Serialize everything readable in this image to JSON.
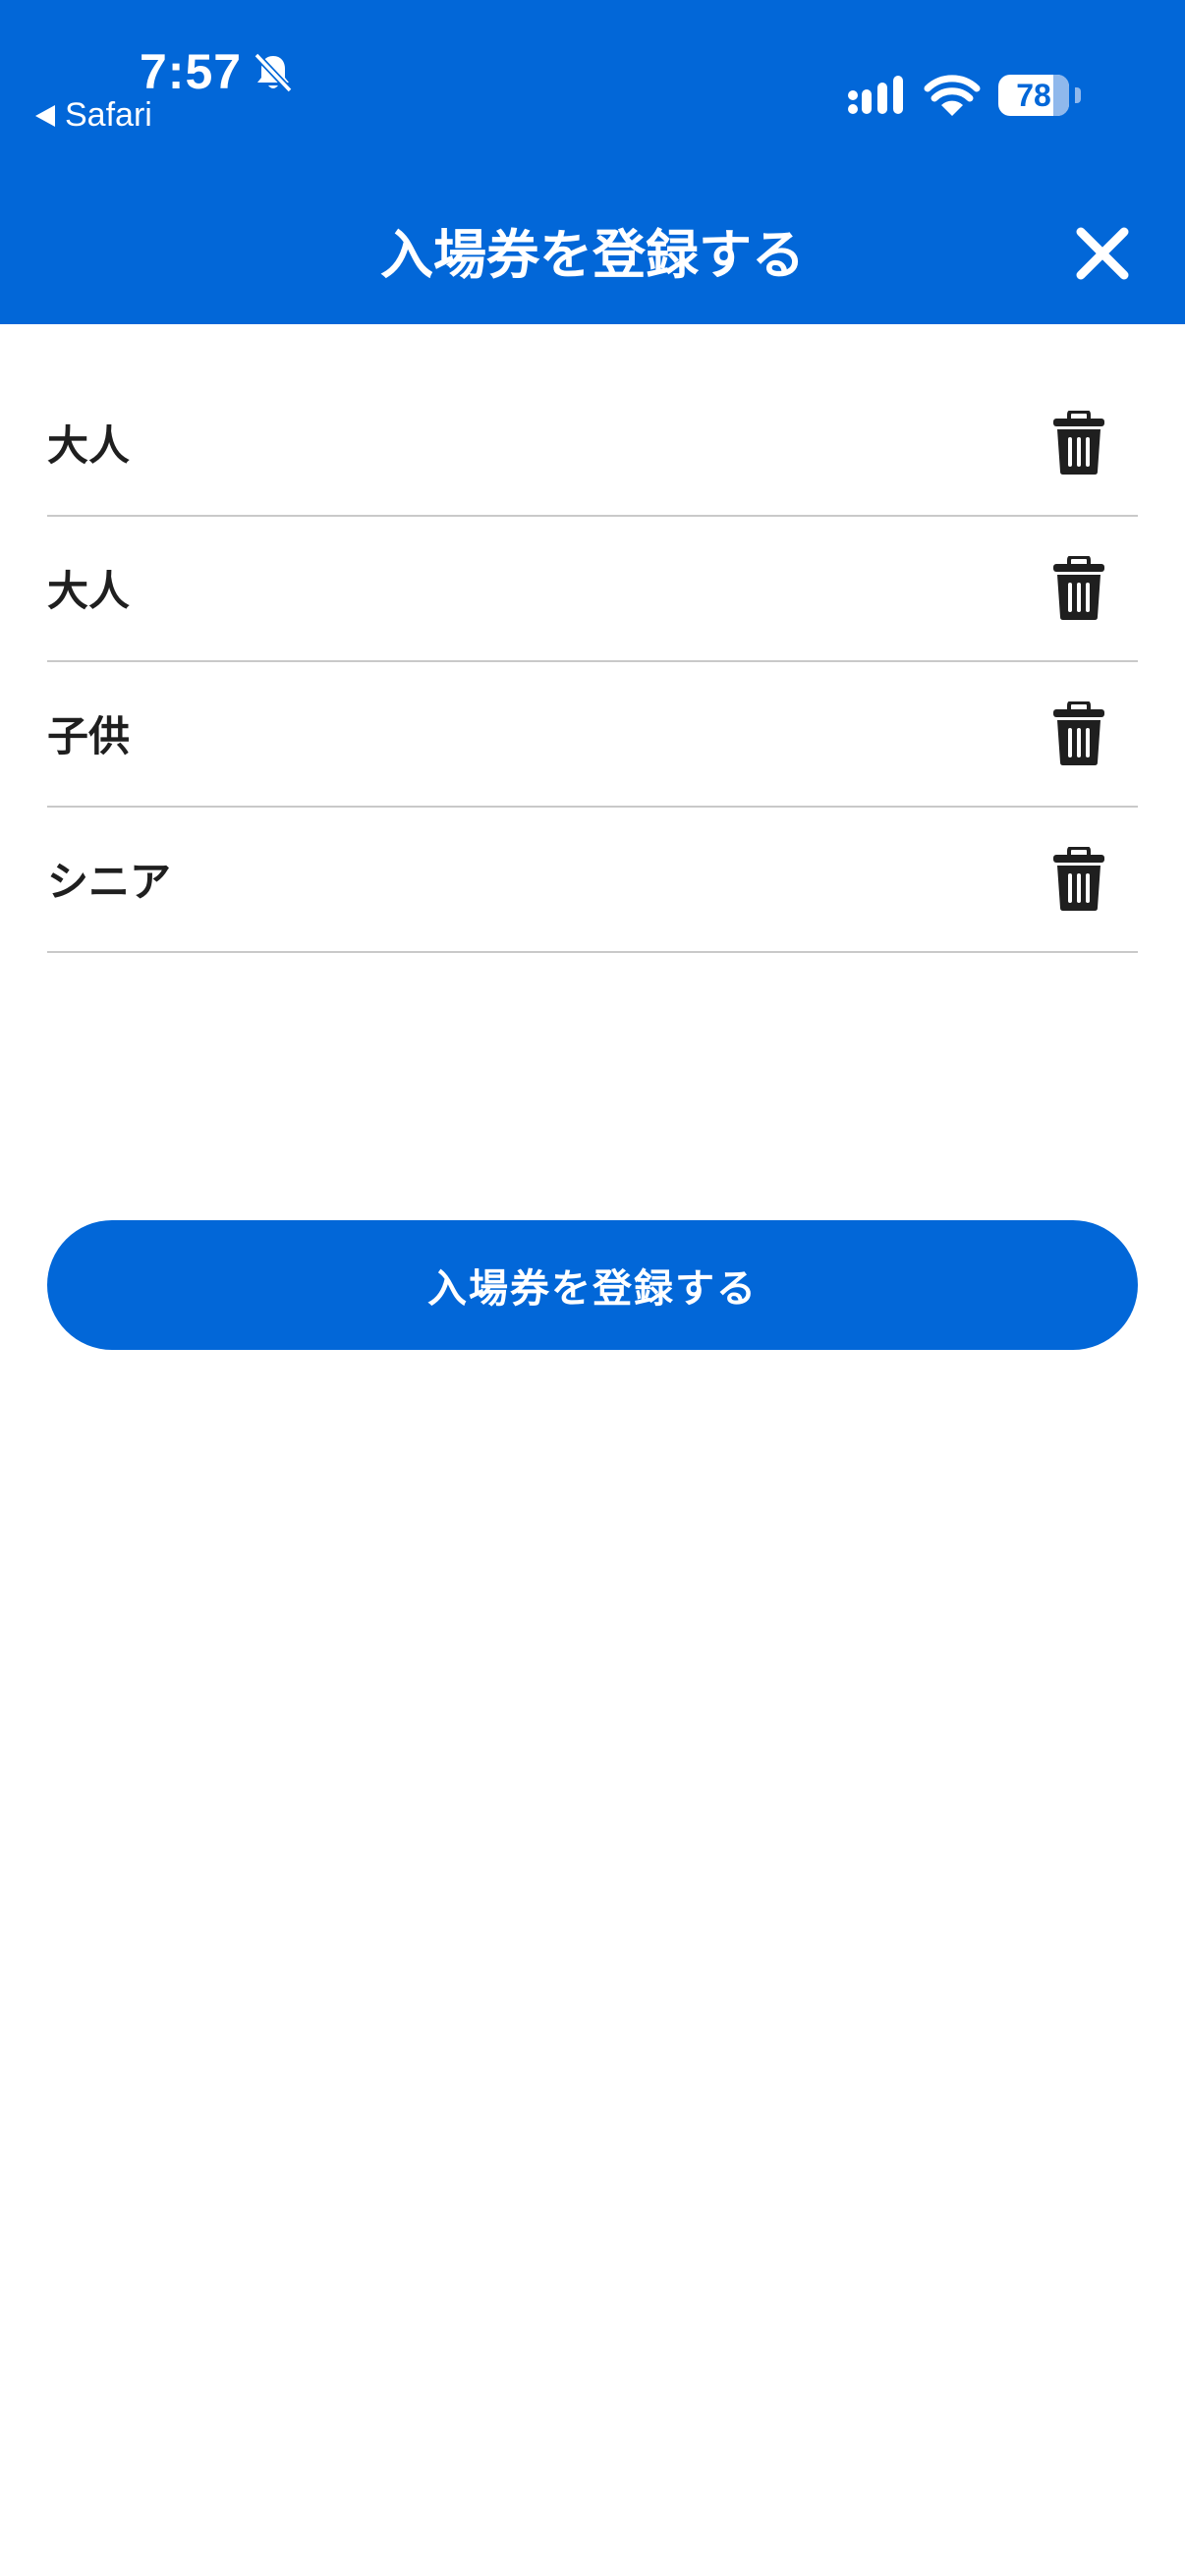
{
  "status_bar": {
    "time": "7:57",
    "back_app": "Safari",
    "battery": "78"
  },
  "header": {
    "title": "入場券を登録する",
    "close_icon": "close-icon"
  },
  "tickets": [
    {
      "label": "大人",
      "icon": "trash-icon"
    },
    {
      "label": "大人",
      "icon": "trash-icon"
    },
    {
      "label": "子供",
      "icon": "trash-icon"
    },
    {
      "label": "シニア",
      "icon": "trash-icon"
    }
  ],
  "submit": {
    "label": "入場券を登録する"
  },
  "colors": {
    "brand": "#0267d8",
    "divider": "#c9c9c9",
    "text": "#1f1f1f"
  }
}
